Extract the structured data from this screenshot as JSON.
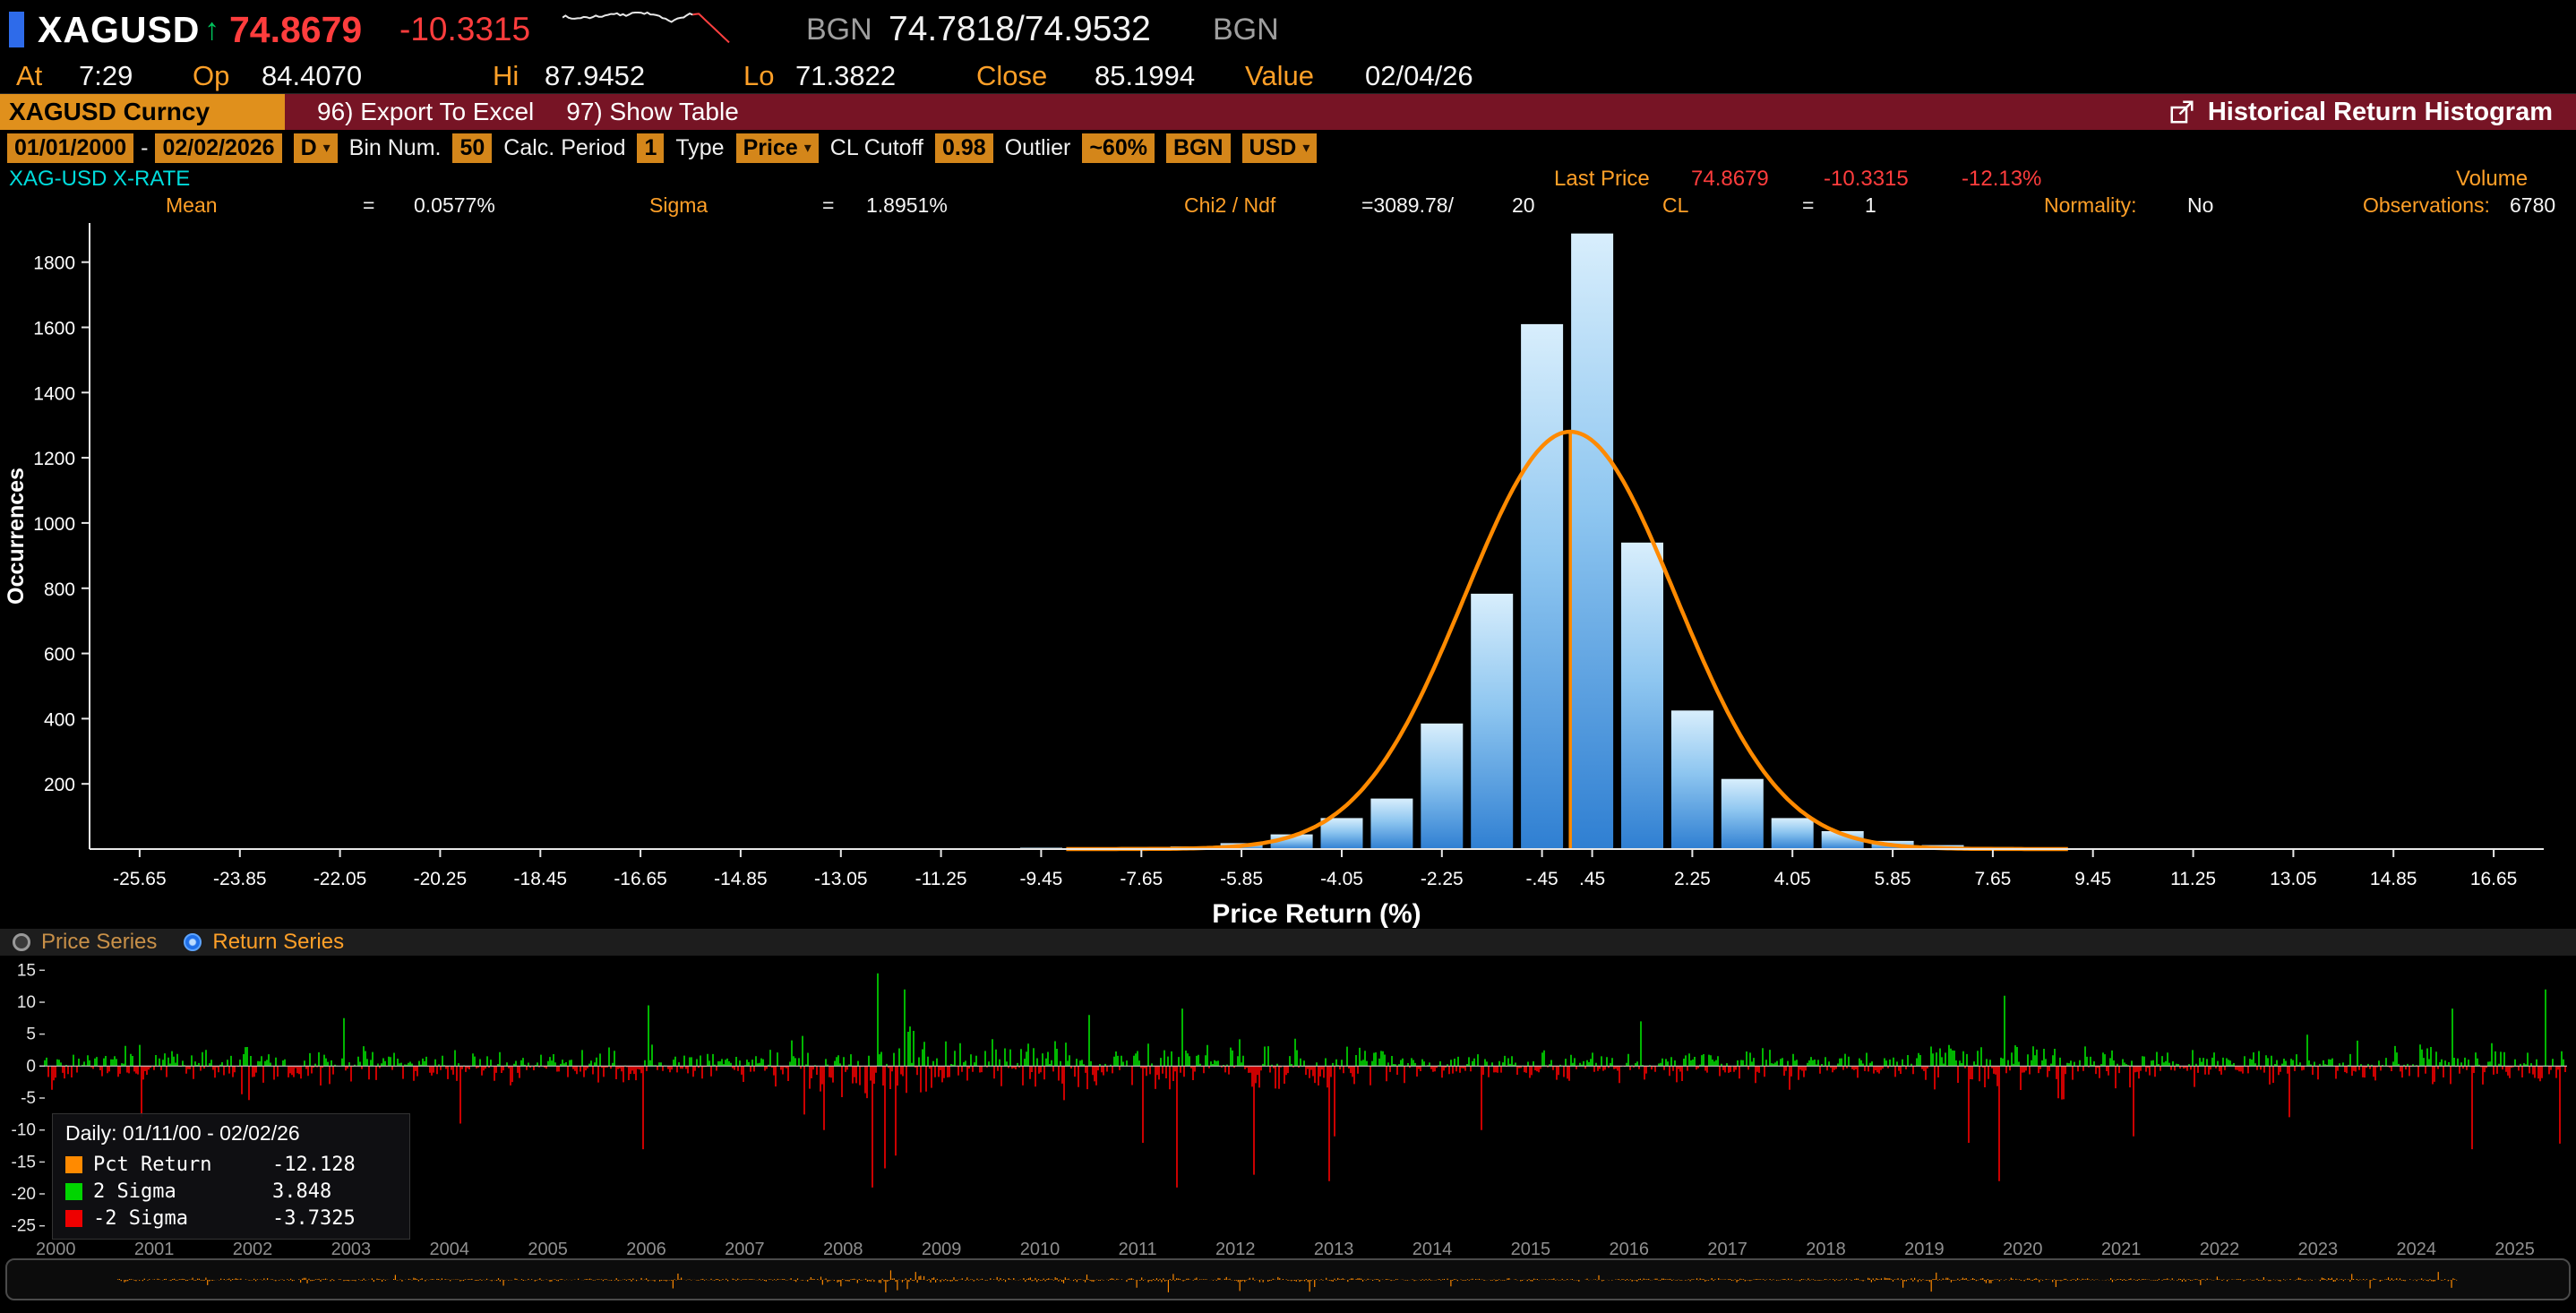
{
  "colors": {
    "amber": "#ffa028",
    "field_amber": "#d4861a",
    "price_red": "#ff3d3d",
    "up_green": "#00d500",
    "down_red": "#ee0000",
    "curve_orange": "#ff8a00",
    "cyan": "#00dcdc",
    "bar_top": "#d8eefc",
    "bar_bottom": "#2f7fd2",
    "radio_blue": "#1f6fe8",
    "menubar_maroon": "#771425"
  },
  "top_bar": {
    "ticker": "XAGUSD",
    "arrow": "↑",
    "price": "74.8679",
    "change": "-10.3315",
    "source_left": "BGN",
    "bid_ask": "74.7818/74.9532",
    "source_right": "BGN"
  },
  "quote_row": {
    "at_label": "At",
    "at_value": "7:29",
    "op_label": "Op",
    "op_value": "84.4070",
    "hi_label": "Hi",
    "hi_value": "87.9452",
    "lo_label": "Lo",
    "lo_value": "71.3822",
    "close_label": "Close",
    "close_value": "85.1994",
    "value_label": "Value",
    "value_value": "02/04/26"
  },
  "menu_bar": {
    "security": "XAGUSD Curncy",
    "export_label": "96) Export To Excel",
    "show_table_label": "97) Show Table",
    "title": "Historical Return Histogram"
  },
  "toolbar": {
    "date_from": "01/01/2000",
    "date_sep": "-",
    "date_to": "02/02/2026",
    "period": "D",
    "bin_label": "Bin Num.",
    "bin_value": "50",
    "calc_label": "Calc. Period",
    "calc_value": "1",
    "type_label": "Type",
    "type_value": "Price",
    "cl_label": "CL Cutoff",
    "cl_value": "0.98",
    "outlier_label": "Outlier",
    "outlier_value": "~60%",
    "bgn": "BGN",
    "currency": "USD"
  },
  "info_row": {
    "security_name": "XAG-USD X-RATE",
    "last_price_label": "Last Price",
    "last_price": "74.8679",
    "last_change": "-10.3315",
    "last_change_pct": "-12.13%",
    "volume_label": "Volume"
  },
  "stats_row": {
    "mean_label": "Mean",
    "mean_eq": "=",
    "mean": "0.0577%",
    "sigma_label": "Sigma",
    "sigma_eq": "=",
    "sigma": "1.8951%",
    "chi2_label": "Chi2 / Ndf",
    "chi2": "=3089.78/",
    "ndf": "20",
    "cl_label": "CL",
    "cl_eq": "=",
    "cl": "1",
    "normality_label": "Normality:",
    "normality": "No",
    "obs_label": "Observations:",
    "obs": "6780"
  },
  "series_toggle": {
    "price_series": "Price Series",
    "return_series": "Return Series"
  },
  "legend": {
    "title": "Daily: 01/11/00 - 02/02/26",
    "items": [
      {
        "label": "Pct Return",
        "value": "-12.128",
        "color": "#ff8a00"
      },
      {
        "label": "2 Sigma",
        "value": "3.848",
        "color": "#00d500"
      },
      {
        "label": "-2 Sigma",
        "value": "-3.7325",
        "color": "#ee0000"
      }
    ]
  },
  "timeline_years": [
    "2000",
    "2001",
    "2002",
    "2003",
    "2004",
    "2005",
    "2006",
    "2007",
    "2008",
    "2009",
    "2010",
    "2011",
    "2012",
    "2013",
    "2014",
    "2015",
    "2016",
    "2017",
    "2018",
    "2019",
    "2020",
    "2021",
    "2022",
    "2023",
    "2024",
    "2025"
  ],
  "chart_data": [
    {
      "type": "bar",
      "title": "Historical Return Histogram",
      "xlabel": "Price Return (%)",
      "ylabel": "Occurrences",
      "xlim": [
        -26.55,
        17.55
      ],
      "ylim": [
        0,
        1920
      ],
      "bin_width": 0.9,
      "grid": false,
      "y_ticks": [
        200,
        400,
        600,
        800,
        1000,
        1200,
        1400,
        1600,
        1800
      ],
      "x_ticks": [
        -25.65,
        -23.85,
        -22.05,
        -20.25,
        -18.45,
        -16.65,
        -14.85,
        -13.05,
        -11.25,
        -9.45,
        -7.65,
        -5.85,
        -4.05,
        -2.25,
        -0.45,
        0.45,
        2.25,
        4.05,
        5.85,
        7.65,
        9.45,
        11.25,
        13.05,
        14.85,
        16.65
      ],
      "x_tick_labels": [
        "-25.65",
        "-23.85",
        "-22.05",
        "-20.25",
        "-18.45",
        "-16.65",
        "-14.85",
        "-13.05",
        "-11.25",
        "-9.45",
        "-7.65",
        "-5.85",
        "-4.05",
        "-2.25",
        "-.45",
        ".45",
        "2.25",
        "4.05",
        "5.85",
        "7.65",
        "9.45",
        "11.25",
        "13.05",
        "14.85",
        "16.65"
      ],
      "bars": [
        {
          "x": -10.35,
          "count": 2
        },
        {
          "x": -9.45,
          "count": 4
        },
        {
          "x": -8.55,
          "count": 3
        },
        {
          "x": -7.65,
          "count": 6
        },
        {
          "x": -6.75,
          "count": 8
        },
        {
          "x": -5.85,
          "count": 18
        },
        {
          "x": -4.95,
          "count": 45
        },
        {
          "x": -4.05,
          "count": 95
        },
        {
          "x": -3.15,
          "count": 155
        },
        {
          "x": -2.25,
          "count": 385
        },
        {
          "x": -1.35,
          "count": 783
        },
        {
          "x": -0.45,
          "count": 1610
        },
        {
          "x": 0.45,
          "count": 1888
        },
        {
          "x": 1.35,
          "count": 940
        },
        {
          "x": 2.25,
          "count": 425
        },
        {
          "x": 3.15,
          "count": 215
        },
        {
          "x": 4.05,
          "count": 95
        },
        {
          "x": 4.95,
          "count": 55
        },
        {
          "x": 5.85,
          "count": 25
        },
        {
          "x": 6.75,
          "count": 12
        },
        {
          "x": 7.65,
          "count": 6
        },
        {
          "x": 8.55,
          "count": 3
        },
        {
          "x": 9.45,
          "count": 2
        }
      ],
      "normal_curve": {
        "mean": 0.0577,
        "sigma": 1.8951,
        "peak": 1280
      },
      "mean_line_x": 0.0577
    },
    {
      "type": "area",
      "name": "Daily Pct Return Series",
      "y_ticks": [
        15,
        10,
        5,
        0,
        -5,
        -10,
        -15,
        -20,
        -25
      ],
      "ylim": [
        -27,
        17
      ],
      "t_range": [
        2000,
        2026.08
      ],
      "base_sigma": 1.2,
      "two_sigma": 3.848,
      "neg_two_sigma": -3.7325,
      "last_return": -12.128,
      "volatility_eras": [
        {
          "from": 2000,
          "to": 2003.5,
          "sigma": 1.5
        },
        {
          "from": 2003.5,
          "to": 2007.5,
          "sigma": 1.25
        },
        {
          "from": 2007.5,
          "to": 2009.5,
          "sigma": 2.4
        },
        {
          "from": 2009.5,
          "to": 2012.6,
          "sigma": 1.9
        },
        {
          "from": 2012.6,
          "to": 2013.9,
          "sigma": 1.7
        },
        {
          "from": 2013.9,
          "to": 2019.5,
          "sigma": 1.1
        },
        {
          "from": 2019.5,
          "to": 2020.9,
          "sigma": 1.9
        },
        {
          "from": 2020.9,
          "to": 2024.5,
          "sigma": 1.3
        },
        {
          "from": 2024.5,
          "to": 2026.08,
          "sigma": 1.6
        }
      ],
      "spikes": [
        {
          "t": 2001.0,
          "v": -8
        },
        {
          "t": 2003.1,
          "v": 7.5
        },
        {
          "t": 2004.3,
          "v": -9
        },
        {
          "t": 2006.18,
          "v": -13
        },
        {
          "t": 2006.24,
          "v": 9.5
        },
        {
          "t": 2008.05,
          "v": -10
        },
        {
          "t": 2008.55,
          "v": -19
        },
        {
          "t": 2008.62,
          "v": 14.5
        },
        {
          "t": 2008.68,
          "v": -16
        },
        {
          "t": 2008.8,
          "v": -14
        },
        {
          "t": 2008.9,
          "v": 12
        },
        {
          "t": 2010.8,
          "v": 8
        },
        {
          "t": 2011.35,
          "v": -12
        },
        {
          "t": 2011.7,
          "v": -19
        },
        {
          "t": 2011.76,
          "v": 9
        },
        {
          "t": 2012.5,
          "v": -17
        },
        {
          "t": 2013.28,
          "v": -18
        },
        {
          "t": 2013.34,
          "v": -11
        },
        {
          "t": 2014.85,
          "v": -10
        },
        {
          "t": 2016.5,
          "v": 7
        },
        {
          "t": 2019.9,
          "v": -12
        },
        {
          "t": 2020.2,
          "v": -18
        },
        {
          "t": 2020.26,
          "v": 11
        },
        {
          "t": 2021.6,
          "v": -11
        },
        {
          "t": 2023.2,
          "v": -8
        },
        {
          "t": 2024.9,
          "v": 9
        },
        {
          "t": 2025.1,
          "v": -13
        },
        {
          "t": 2025.85,
          "v": 12
        },
        {
          "t": 2026.0,
          "v": -12.128
        }
      ]
    },
    {
      "type": "line",
      "name": "return-series-navigator",
      "color": "#ff8a00"
    }
  ]
}
